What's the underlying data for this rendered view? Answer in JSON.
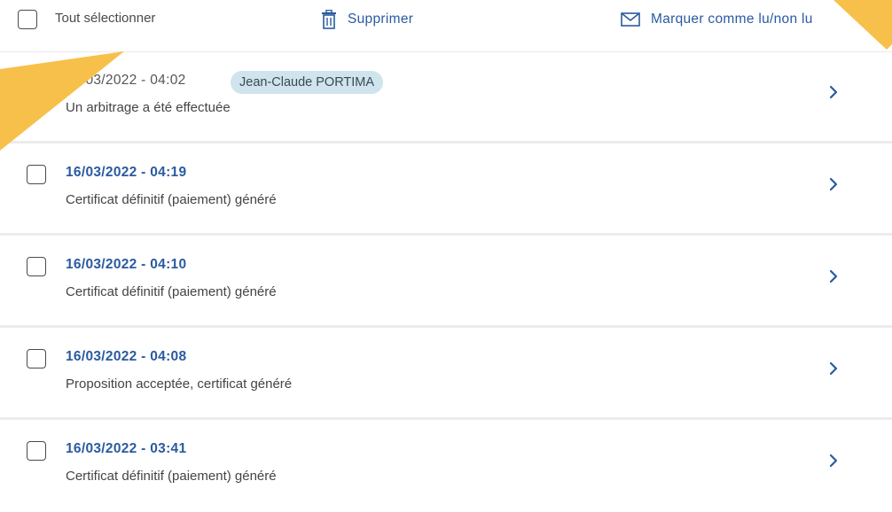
{
  "toolbar": {
    "select_all_label": "Tout sélectionner",
    "delete_label": "Supprimer",
    "mark_label": "Marquer comme lu/non lu"
  },
  "messages": [
    {
      "date": "16/03/2022 - 04:02",
      "sender": "Jean-Claude PORTIMA",
      "description": "Un arbitrage a été effectuée",
      "unread": false
    },
    {
      "date": "16/03/2022 - 04:19",
      "description": "Certificat définitif (paiement) généré",
      "unread": true
    },
    {
      "date": "16/03/2022 - 04:10",
      "description": "Certificat définitif (paiement) généré",
      "unread": true
    },
    {
      "date": "16/03/2022 - 04:08",
      "description": "Proposition acceptée, certificat généré",
      "unread": true
    },
    {
      "date": "16/03/2022 - 03:41",
      "description": "Certificat définitif (paiement) généré",
      "unread": true
    }
  ],
  "icons": {
    "delete": "trash-icon",
    "mark": "envelope-icon",
    "row_action": "chevron-right-icon"
  },
  "colors": {
    "accent": "#2a5aa0",
    "badge_bg": "#cfe4ec",
    "annotation_arrow": "#f7c04a"
  }
}
